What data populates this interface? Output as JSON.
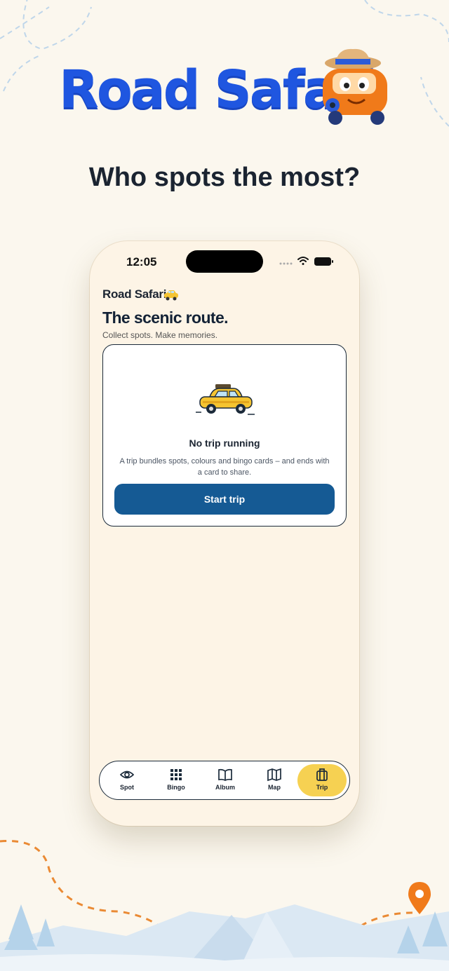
{
  "hero": {
    "title": "Road Safari",
    "tagline": "Who spots the most?"
  },
  "status_bar": {
    "time": "12:05"
  },
  "app": {
    "name": "Road Safari",
    "headline": "The scenic route.",
    "subheadline": "Collect spots. Make memories."
  },
  "trip_card": {
    "title": "No trip running",
    "body": "A trip bundles spots, colours and bingo cards – and ends with a card to share.",
    "button_label": "Start trip"
  },
  "tabs": [
    {
      "label": "Spot",
      "icon": "eye-icon",
      "active": false
    },
    {
      "label": "Bingo",
      "icon": "grid-icon",
      "active": false
    },
    {
      "label": "Album",
      "icon": "book-icon",
      "active": false
    },
    {
      "label": "Map",
      "icon": "map-icon",
      "active": false
    },
    {
      "label": "Trip",
      "icon": "suitcase-icon",
      "active": true
    }
  ],
  "colors": {
    "background": "#fbf7ee",
    "brand_blue": "#1f56e0",
    "primary_button": "#155a94",
    "active_tab": "#f6d152",
    "pin_orange": "#f07a1a"
  }
}
